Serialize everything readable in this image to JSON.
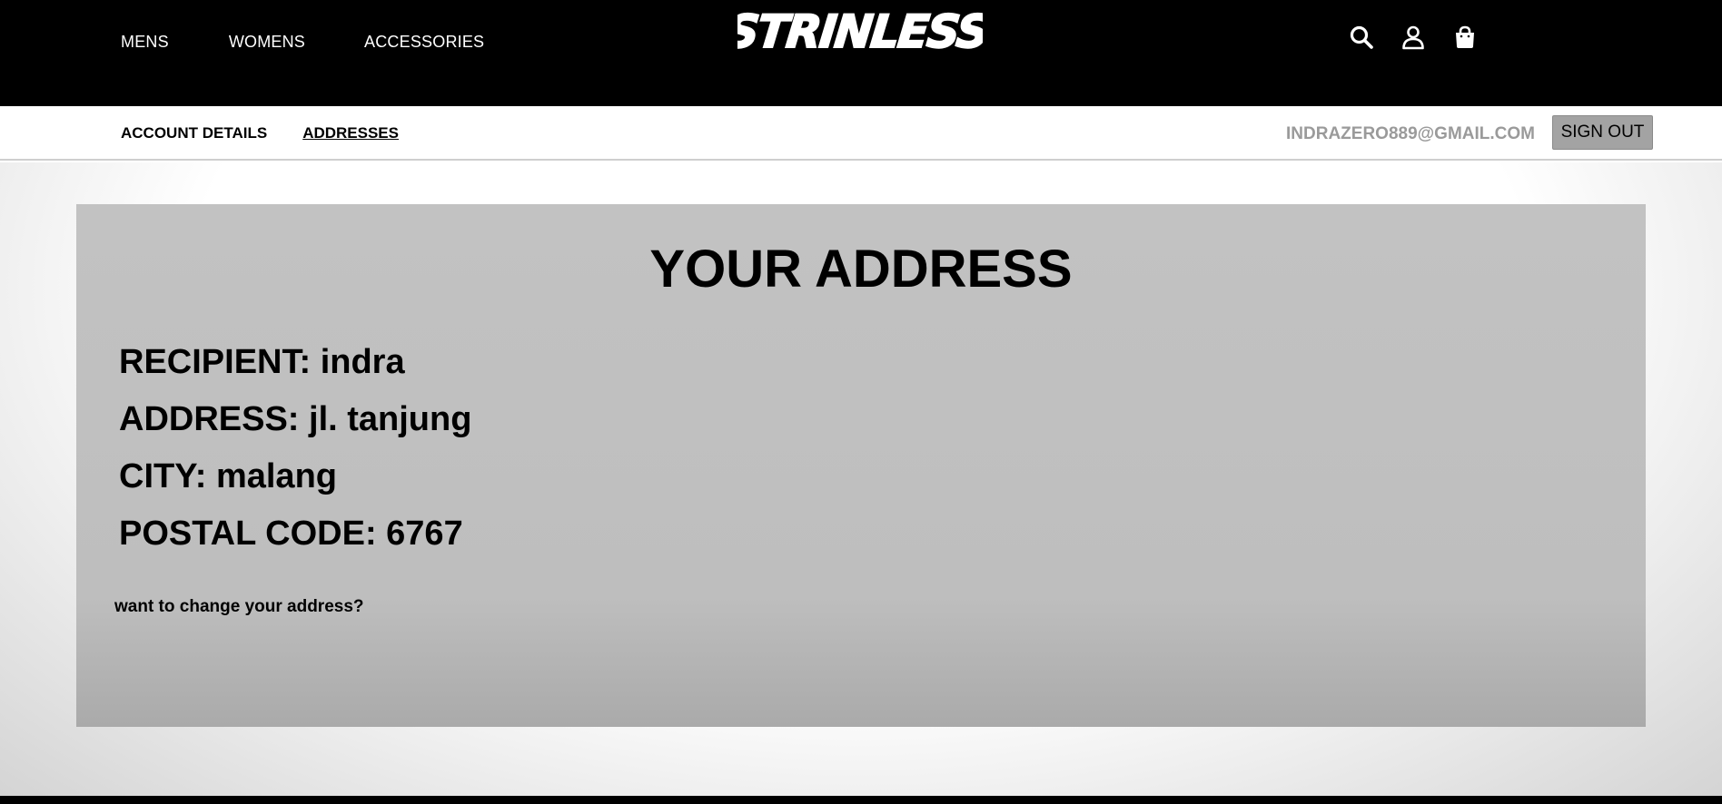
{
  "nav": {
    "mens": "MENS",
    "womens": "WOMENS",
    "accessories": "ACCESSORIES"
  },
  "brand": {
    "logo_text": "STRINLESS"
  },
  "header_icons": [
    "search-icon",
    "user-icon",
    "shopping-bag-icon"
  ],
  "account_nav": {
    "account_details": "ACCOUNT DETAILS",
    "addresses": "ADDRESSES",
    "email": "INDRAZERO889@GMAIL.COM",
    "sign_out": "SIGN OUT"
  },
  "address_card": {
    "title": "YOUR ADDRESS",
    "recipient": "RECIPIENT: indra",
    "address": "ADDRESS: jl. tanjung",
    "city": "CITY: malang",
    "postal_code": "POSTAL CODE: 6767",
    "change_link": "want to change your address?"
  },
  "colors": {
    "header_bg": "#000000",
    "card_bg": "#c2c2c2",
    "email_text": "#9a9a9a",
    "signout_bg": "#a3a3a3"
  }
}
